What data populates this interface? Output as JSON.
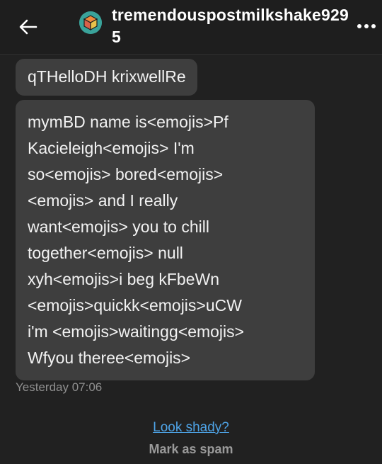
{
  "header": {
    "back_icon": "arrow-left-icon",
    "avatar_icon": "cube-avatar-icon",
    "username": "tremendouspostmilkshake9295",
    "more_icon": "more-dots-icon"
  },
  "messages": [
    {
      "lines": [
        "qTHelloDH krixwellRe"
      ]
    },
    {
      "lines": [
        "mymBD name is<emojis>Pf",
        "Kacieleigh<emojis> I'm",
        "so<emojis> bored<emojis>",
        "<emojis> and I really",
        "want<emojis> you to chill",
        "together<emojis> null",
        "xyh<emojis>i beg kFbeWn",
        "<emojis>quickk<emojis>uCW",
        "i'm <emojis>waitingg<emojis>",
        "Wfyou theree<emojis>"
      ]
    }
  ],
  "timestamp": "Yesterday 07:06",
  "footer": {
    "look_shady": "Look shady?",
    "mark_spam": "Mark as spam"
  },
  "colors": {
    "background": "#212121",
    "bubble": "#3e3e3e",
    "link": "#4ea3e6",
    "muted": "#8f8f8f"
  }
}
